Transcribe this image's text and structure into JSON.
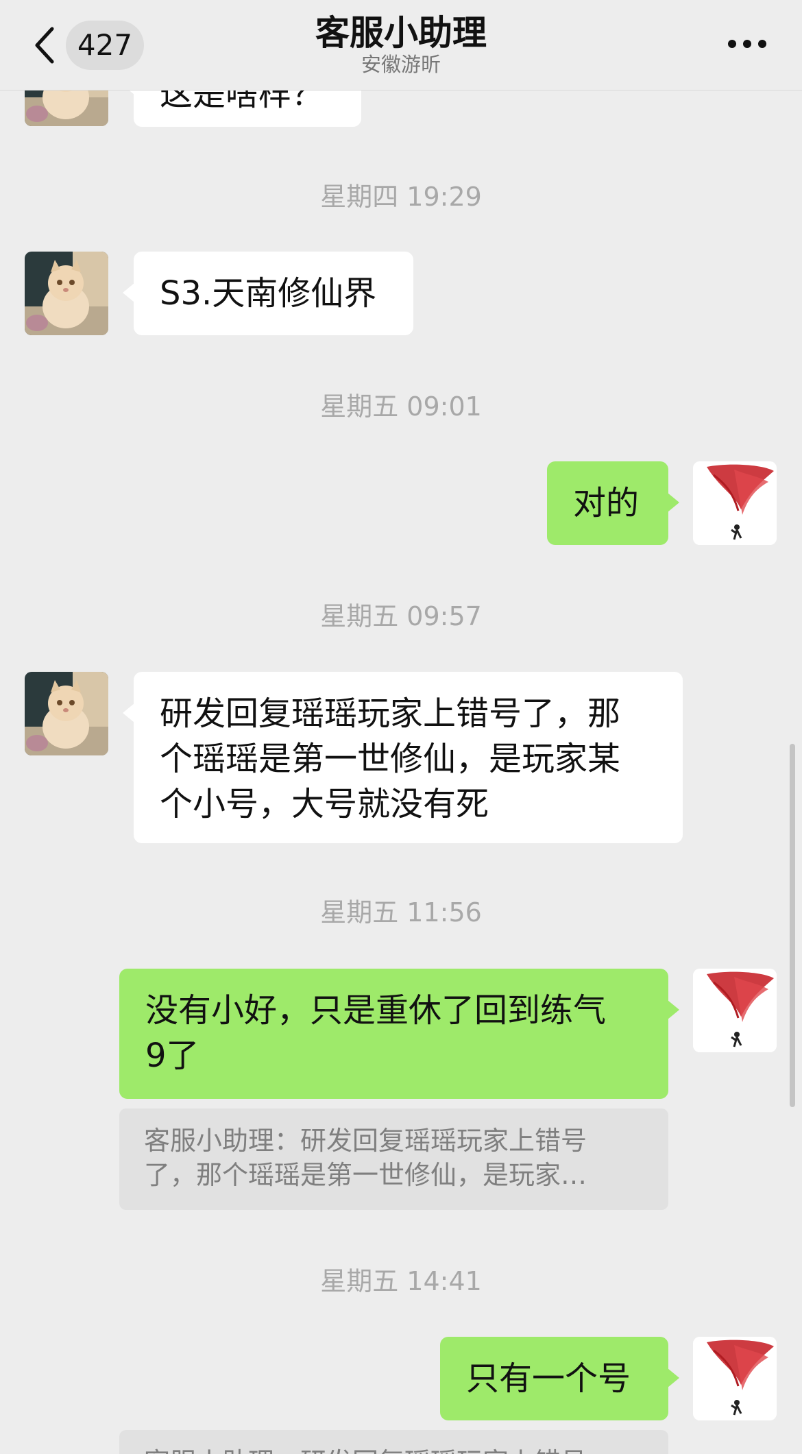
{
  "nav": {
    "unread_count": "427",
    "title": "客服小助理",
    "subtitle": "安徽游昕"
  },
  "messages": [
    {
      "kind": "incoming",
      "text": "这是啥样？",
      "partial": true
    },
    {
      "kind": "timestamp",
      "text": "星期四 19:29"
    },
    {
      "kind": "incoming",
      "text": "S3.天南修仙界"
    },
    {
      "kind": "timestamp",
      "text": "星期五 09:01"
    },
    {
      "kind": "outgoing",
      "text": "对的"
    },
    {
      "kind": "timestamp",
      "text": "星期五 09:57"
    },
    {
      "kind": "incoming",
      "text": "研发回复瑶瑶玩家上错号了，那\n个瑶瑶是第一世修仙，是玩家某\n个小号，大号就没有死"
    },
    {
      "kind": "timestamp",
      "text": "星期五 11:56"
    },
    {
      "kind": "outgoing",
      "text": "没有小好，只是重休了回到练气\n9了"
    },
    {
      "kind": "quote",
      "text": "客服小助理：研发回复瑶瑶玩家上错号\n了，那个瑶瑶是第一世修仙，是玩家…"
    },
    {
      "kind": "timestamp",
      "text": "星期五 14:41"
    },
    {
      "kind": "outgoing",
      "text": "只有一个号"
    },
    {
      "kind": "quote",
      "text": "客服小助理：研发回复瑶瑶玩家上错号",
      "partial": true
    }
  ],
  "colors": {
    "background": "#ededed",
    "incoming_bubble": "#ffffff",
    "outgoing_bubble": "#9eea6a",
    "timestamp_text": "#a8a8a8",
    "quote_background": "#e1e1e1"
  },
  "icons": {
    "back": "chevron-left-icon",
    "more": "more-dots-icon",
    "contact_avatar": "cat-avatar",
    "self_avatar": "ink-painting-avatar"
  }
}
